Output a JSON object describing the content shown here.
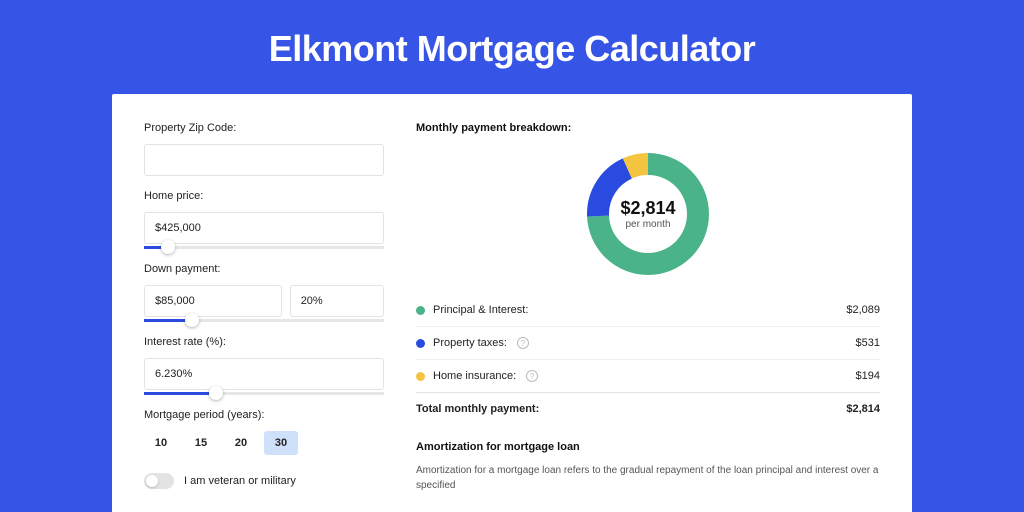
{
  "title": "Elkmont Mortgage Calculator",
  "form": {
    "zip_label": "Property Zip Code:",
    "zip_value": "",
    "home_price_label": "Home price:",
    "home_price_value": "$425,000",
    "home_price_slider_pct": 10,
    "down_payment_label": "Down payment:",
    "down_payment_value": "$85,000",
    "down_payment_pct_value": "20%",
    "down_payment_slider_pct": 20,
    "interest_label": "Interest rate (%):",
    "interest_value": "6.230%",
    "interest_slider_pct": 30,
    "period_label": "Mortgage period (years):",
    "periods": [
      "10",
      "15",
      "20",
      "30"
    ],
    "period_selected": "30",
    "veteran_label": "I am veteran or military"
  },
  "breakdown": {
    "title": "Monthly payment breakdown:",
    "center_value": "$2,814",
    "center_sub": "per month",
    "rows": {
      "pi_label": "Principal & Interest:",
      "pi_value": "$2,089",
      "tax_label": "Property taxes:",
      "tax_value": "$531",
      "ins_label": "Home insurance:",
      "ins_value": "$194",
      "total_label": "Total monthly payment:",
      "total_value": "$2,814"
    }
  },
  "amort": {
    "title": "Amortization for mortgage loan",
    "text": "Amortization for a mortgage loan refers to the gradual repayment of the loan principal and interest over a specified"
  },
  "chart_data": {
    "type": "pie",
    "title": "Monthly payment breakdown",
    "series": [
      {
        "name": "Principal & Interest",
        "value": 2089,
        "color": "#4ab38a"
      },
      {
        "name": "Property taxes",
        "value": 531,
        "color": "#2a4be0"
      },
      {
        "name": "Home insurance",
        "value": 194,
        "color": "#f5c542"
      }
    ],
    "total": 2814
  }
}
